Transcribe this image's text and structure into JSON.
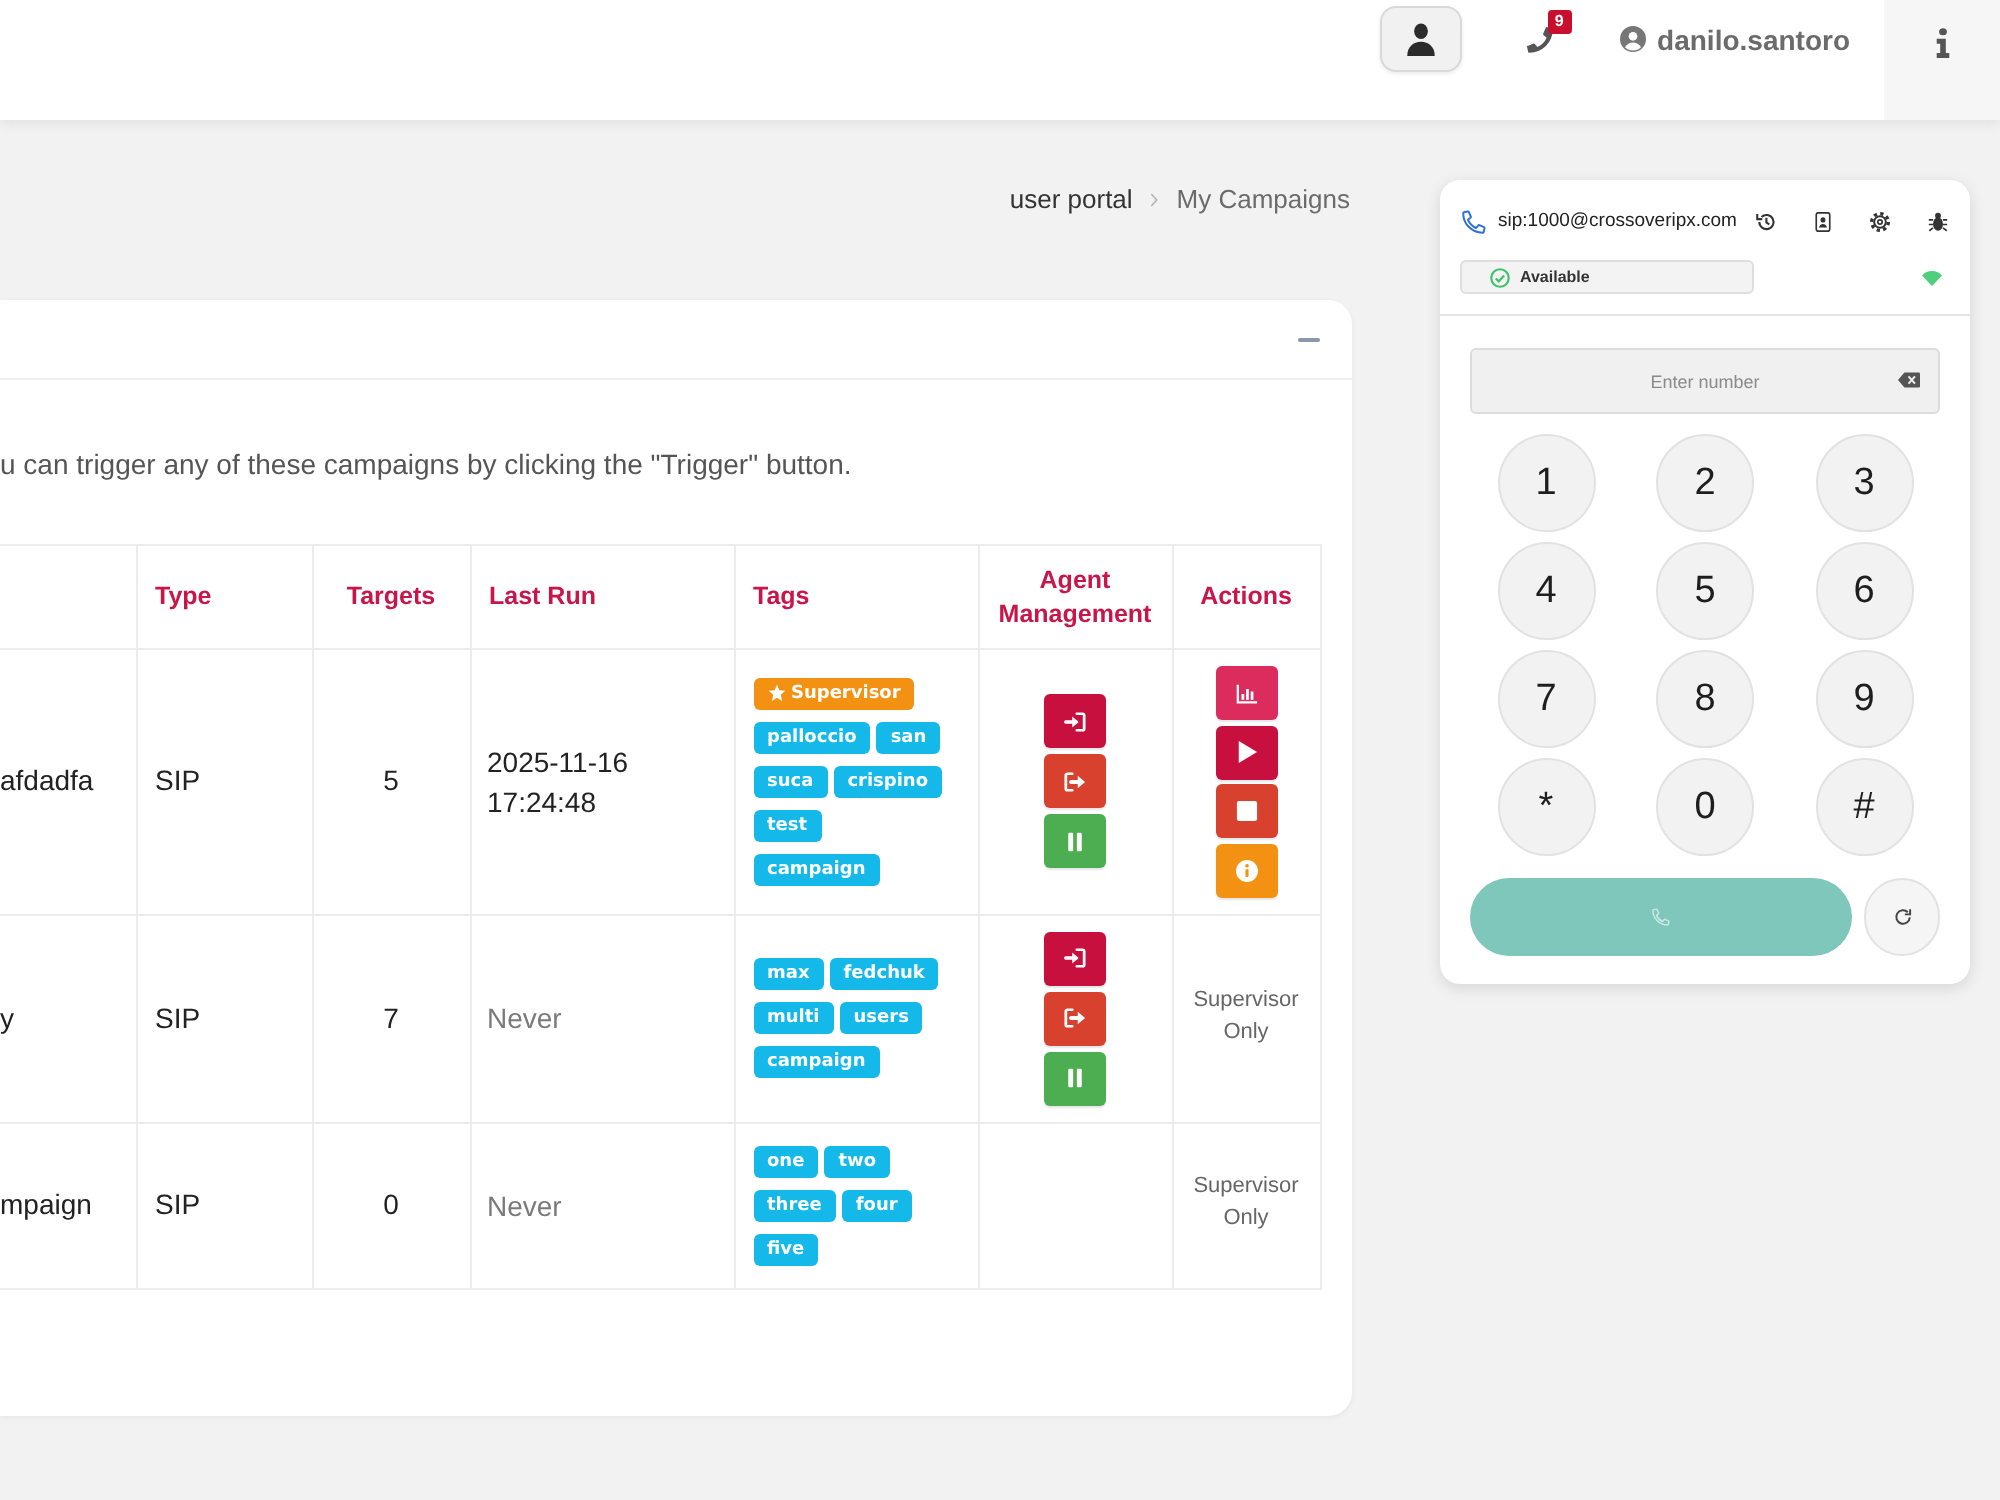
{
  "top_bar": {
    "notification_count": "9",
    "username": "danilo.santoro"
  },
  "breadcrumb": [
    {
      "label": "user portal"
    },
    {
      "label": "My Campaigns"
    }
  ],
  "campaigns_card": {
    "description": "u can trigger any of these campaigns by clicking the \"Trigger\" button.",
    "table": {
      "columns": [
        "Type",
        "Targets",
        "Last Run",
        "Tags",
        "Agent Management",
        "Actions"
      ],
      "rows": [
        {
          "column_1": "afdadfa",
          "type": "SIP",
          "targets": "5",
          "last_run": {
            "text": "2025-11-16 17:24:48",
            "muted": false
          },
          "tags": [
            {
              "kind": "role",
              "label": "Supervisor"
            },
            {
              "kind": "label",
              "label": "palloccio"
            },
            {
              "kind": "label",
              "label": "san"
            },
            {
              "kind": "label",
              "label": "suca"
            },
            {
              "kind": "label",
              "label": "crispino"
            },
            {
              "kind": "label",
              "label": "test"
            },
            {
              "kind": "label",
              "label": "campaign"
            }
          ],
          "agent_buttons": [
            {
              "kind": "login"
            },
            {
              "kind": "logout"
            },
            {
              "kind": "pause"
            }
          ],
          "actions": [
            {
              "kind": "stats"
            },
            {
              "kind": "play"
            },
            {
              "kind": "stop"
            },
            {
              "kind": "info"
            }
          ]
        },
        {
          "column_1": "y",
          "type": "SIP",
          "targets": "7",
          "last_run": {
            "text": "Never",
            "muted": true
          },
          "tags": [
            {
              "kind": "label",
              "label": "max"
            },
            {
              "kind": "label",
              "label": "fedchuk"
            },
            {
              "kind": "label",
              "label": "multi"
            },
            {
              "kind": "label",
              "label": "users"
            },
            {
              "kind": "label",
              "label": "campaign"
            }
          ],
          "agent_buttons": [
            {
              "kind": "login"
            },
            {
              "kind": "logout"
            },
            {
              "kind": "pause"
            }
          ],
          "actions_note": "Supervisor Only"
        },
        {
          "column_1": "mpaign",
          "type": "SIP",
          "targets": "0",
          "last_run": {
            "text": "Never",
            "muted": true
          },
          "tags": [
            {
              "kind": "label",
              "label": "one"
            },
            {
              "kind": "label",
              "label": "two"
            },
            {
              "kind": "label",
              "label": "three"
            },
            {
              "kind": "label",
              "label": "four"
            },
            {
              "kind": "label",
              "label": "five"
            }
          ],
          "actions_note": "Supervisor Only"
        }
      ]
    }
  },
  "dialer": {
    "account": "sip:1000@crossoveripx.com",
    "status": "Available",
    "number_field": {
      "placeholder": "Enter number"
    },
    "keys": [
      "1",
      "2",
      "3",
      "4",
      "5",
      "6",
      "7",
      "8",
      "9",
      "*",
      "0",
      "#"
    ]
  }
}
